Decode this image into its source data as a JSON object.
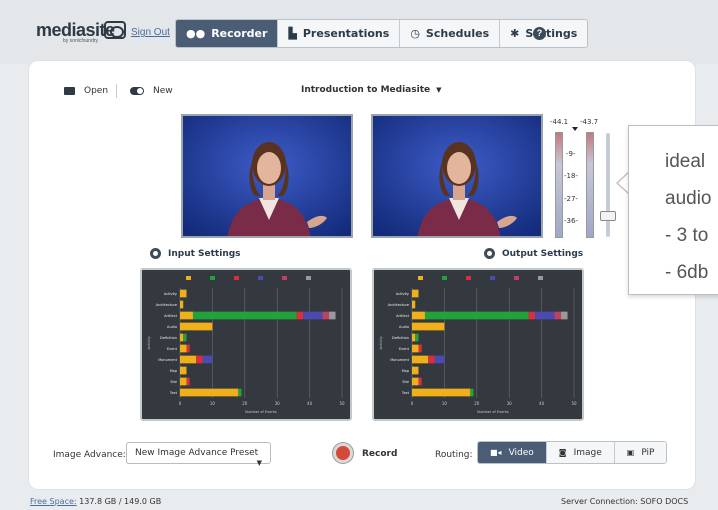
{
  "header": {
    "logo_text": "mediasite",
    "logo_sub": "by sonicfoundry",
    "sign_out": "Sign Out",
    "tabs": [
      {
        "label": "Recorder",
        "icon": "record-icon",
        "active": true
      },
      {
        "label": "Presentations",
        "icon": "presentations-icon",
        "active": false
      },
      {
        "label": "Schedules",
        "icon": "clock-icon",
        "active": false
      },
      {
        "label": "Settings",
        "icon": "gear-icon",
        "active": false
      }
    ],
    "help": "?"
  },
  "toolbar": {
    "open_label": "Open",
    "new_label": "New",
    "presentation_title": "Introduction to Mediasite"
  },
  "audio": {
    "left_value": "-44.1",
    "right_value": "-43.7",
    "ticks": [
      "-9-",
      "-18-",
      "-27-",
      "-36-"
    ]
  },
  "settings": {
    "input_label": "Input Settings",
    "output_label": "Output Settings"
  },
  "chart_data": [
    {
      "type": "bar",
      "title": "",
      "xlabel": "Number of Events",
      "ylabel": "Activity",
      "categories": [
        "Activity",
        "Architecture",
        "Artifact",
        "Audio",
        "Definition",
        "Event",
        "Monument",
        "Map",
        "Site",
        "Text"
      ],
      "xlim": [
        0,
        50
      ],
      "series": [
        {
          "color": "#f0b01a",
          "values": [
            2,
            1,
            4,
            10,
            1,
            2,
            5,
            2,
            2,
            18
          ]
        },
        {
          "color": "#22a33a",
          "values": [
            0,
            0,
            32,
            0,
            1,
            0,
            0,
            0,
            0,
            1
          ]
        },
        {
          "color": "#d8303a",
          "values": [
            0,
            0,
            2,
            0,
            0,
            1,
            2,
            0,
            1,
            0
          ]
        },
        {
          "color": "#4a4ab0",
          "values": [
            0,
            0,
            6,
            0,
            0,
            0,
            3,
            0,
            0,
            0
          ]
        },
        {
          "color": "#c04060",
          "values": [
            0,
            0,
            2,
            0,
            0,
            0,
            0,
            0,
            0,
            0
          ]
        },
        {
          "color": "#999999",
          "values": [
            0,
            0,
            2,
            0,
            0,
            0,
            0,
            0,
            0,
            0
          ]
        }
      ]
    },
    {
      "type": "bar",
      "title": "",
      "xlabel": "Number of Events",
      "ylabel": "Activity",
      "categories": [
        "Activity",
        "Architecture",
        "Artifact",
        "Audio",
        "Definition",
        "Event",
        "Monument",
        "Map",
        "Site",
        "Text"
      ],
      "xlim": [
        0,
        50
      ],
      "series": [
        {
          "color": "#f0b01a",
          "values": [
            2,
            1,
            4,
            10,
            1,
            2,
            5,
            2,
            2,
            18
          ]
        },
        {
          "color": "#22a33a",
          "values": [
            0,
            0,
            32,
            0,
            1,
            0,
            0,
            0,
            0,
            1
          ]
        },
        {
          "color": "#d8303a",
          "values": [
            0,
            0,
            2,
            0,
            0,
            1,
            2,
            0,
            1,
            0
          ]
        },
        {
          "color": "#4a4ab0",
          "values": [
            0,
            0,
            6,
            0,
            0,
            0,
            3,
            0,
            0,
            0
          ]
        },
        {
          "color": "#c04060",
          "values": [
            0,
            0,
            2,
            0,
            0,
            0,
            0,
            0,
            0,
            0
          ]
        },
        {
          "color": "#999999",
          "values": [
            0,
            0,
            2,
            0,
            0,
            0,
            0,
            0,
            0,
            0
          ]
        }
      ]
    }
  ],
  "controls": {
    "image_advance_label": "Image Advance:",
    "image_advance_value": "New Image Advance Preset",
    "record_label": "Record",
    "routing_label": "Routing:",
    "routing_options": [
      {
        "label": "Video",
        "icon": "video-icon",
        "active": true
      },
      {
        "label": "Image",
        "icon": "camera-icon",
        "active": false
      },
      {
        "label": "PiP",
        "icon": "pip-icon",
        "active": false
      }
    ]
  },
  "footer": {
    "free_space_label": "Free Space:",
    "free_space_value": "137.8 GB / 149.0 GB",
    "server_connection": "Server Connection: SOFO DOCS"
  },
  "callout": {
    "lines": [
      "ideal",
      "audio",
      "- 3 to",
      "- 6db"
    ]
  },
  "colors": {
    "nav_active": "#4a5d75",
    "record_red": "#d34a3a",
    "chart_bg": "#34383f"
  }
}
